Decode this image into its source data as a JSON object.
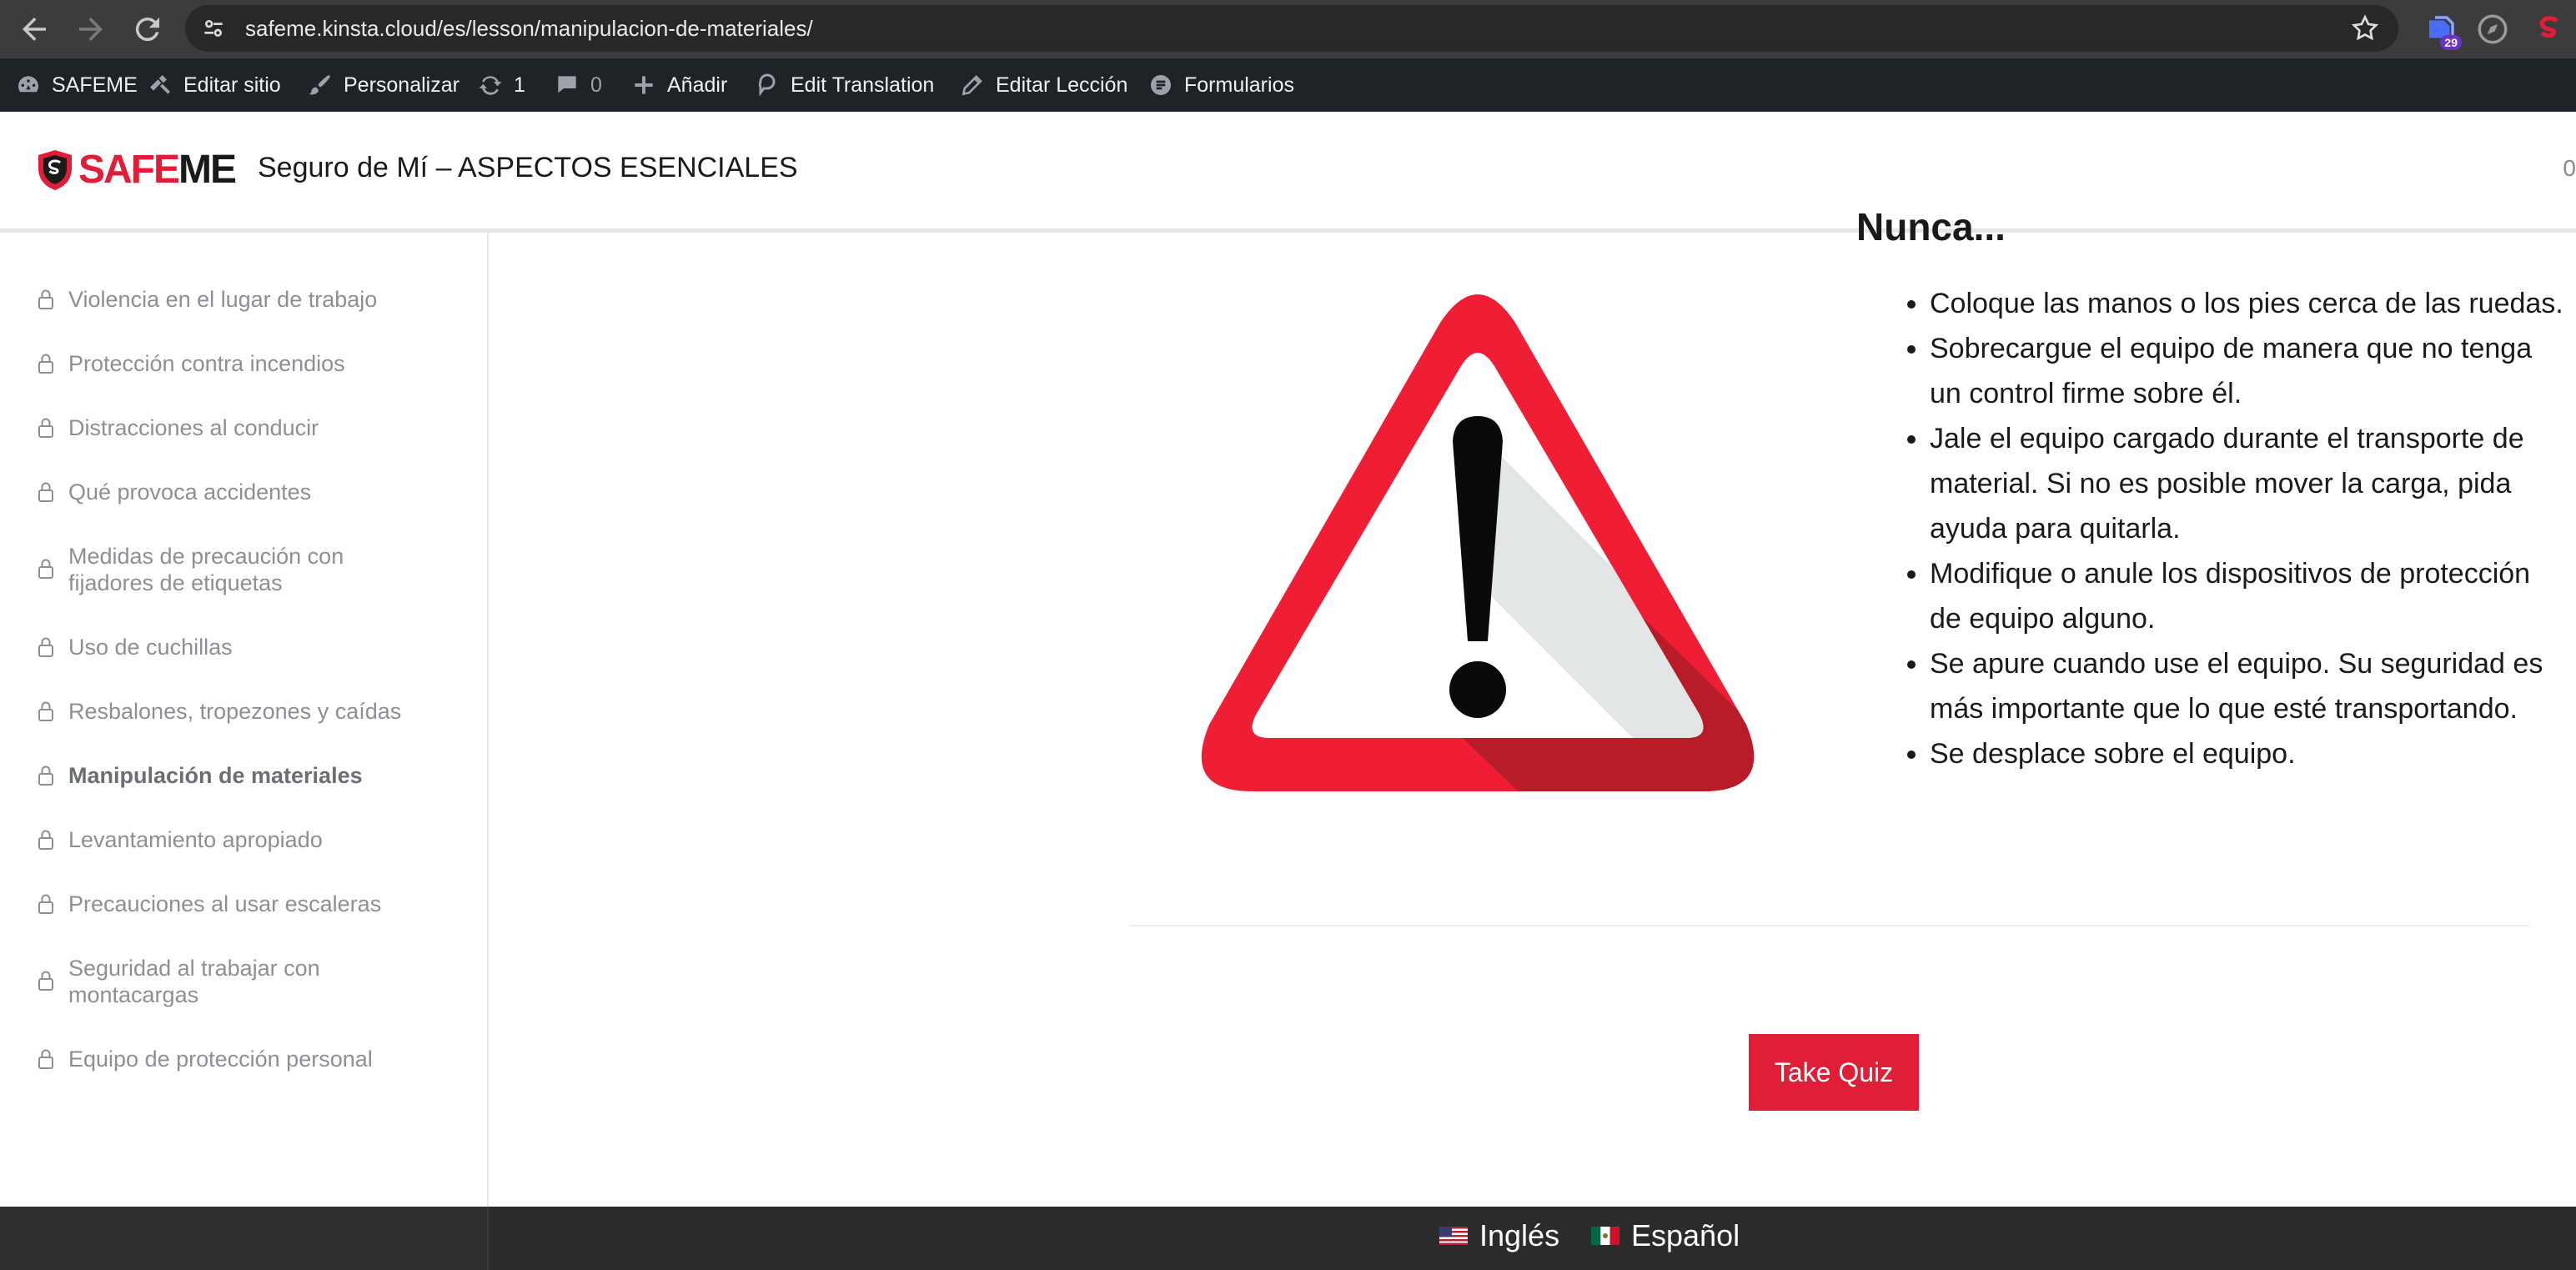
{
  "browser": {
    "url": "safeme.kinsta.cloud/es/lesson/manipulacion-de-materiales/",
    "extension_badge": "29",
    "icons": [
      "back-icon",
      "forward-icon",
      "reload-icon",
      "site-info-icon",
      "star-icon"
    ]
  },
  "adminbar": {
    "site_name": "SAFEME",
    "edit_site": "Editar sitio",
    "customize": "Personalizar",
    "updates_count": "1",
    "comments_count": "0",
    "add_new": "Añadir",
    "edit_translation": "Edit Translation",
    "edit_lesson": "Editar Lección",
    "forms": "Formularios"
  },
  "header": {
    "logo_safe": "SAFE",
    "logo_me": "ME",
    "course_title": "Seguro de Mí – ASPECTOS ESENCIALES",
    "right_text": "0"
  },
  "sidebar": {
    "lessons": [
      {
        "label": "Violencia en el lugar de trabajo"
      },
      {
        "label": "Protección contra incendios"
      },
      {
        "label": "Distracciones al conducir"
      },
      {
        "label": "Qué provoca accidentes"
      },
      {
        "label": "Medidas de precaución con fijadores de etiquetas"
      },
      {
        "label": "Uso de cuchillas"
      },
      {
        "label": "Resbalones, tropezones y caídas"
      },
      {
        "label": "Manipulación de materiales",
        "current": true
      },
      {
        "label": "Levantamiento apropiado"
      },
      {
        "label": "Precauciones al usar escaleras"
      },
      {
        "label": "Seguridad al trabajar con montacargas"
      },
      {
        "label": "Equipo de protección personal"
      }
    ]
  },
  "content": {
    "heading_partial": "Nunca...",
    "bullets": [
      "Coloque las manos o los pies cerca de las ruedas.",
      "Sobrecargue el equipo de manera que no tenga un control firme sobre él.",
      "Jale el equipo cargado durante el transporte de material. Si no es posible mover la carga, pida ayuda para quitarla.",
      "Modifique o anule los dispositivos de protección de equipo alguno.",
      "Se apure cuando use el equipo. Su seguridad es más importante que lo que esté transportando.",
      "Se desplace sobre el equipo."
    ],
    "quiz_button": "Take Quiz"
  },
  "footer": {
    "languages": [
      "Inglés",
      "Español"
    ]
  },
  "colors": {
    "brand_red": "#e01e37",
    "admin_bar": "#1d2327",
    "footer": "#2b2b2b"
  }
}
